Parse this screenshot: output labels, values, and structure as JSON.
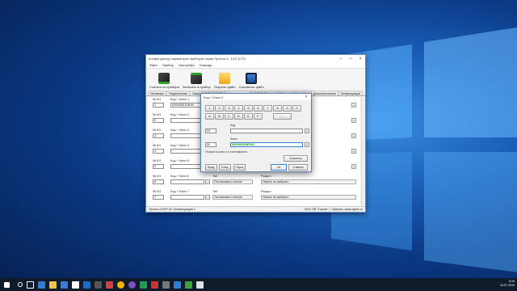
{
  "colors": {
    "accent": "#2f7fd6",
    "key_green": "#1a9a1a"
  },
  "main_window": {
    "title": "Конфигуратор параметров приборов серии Проток-4 - 14.0 (173)",
    "menu": [
      "Файл",
      "Прибор",
      "Настройка",
      "Помощь"
    ],
    "toolbar": [
      {
        "label": "Считать из прибора",
        "icon": "read-device-icon"
      },
      {
        "label": "Записать в прибор",
        "icon": "write-device-icon"
      },
      {
        "label": "Открыть файл",
        "icon": "folder-icon"
      },
      {
        "label": "Сохранить файл",
        "icon": "floppy-icon"
      }
    ],
    "tabs": [
      "Основные",
      "Подключение",
      "Связь",
      "GSM",
      "Wi-Fi",
      "Ключи и входы",
      "SMS",
      "Питание",
      "Выходы",
      "Шлейфы",
      "Дополнительные",
      "Конфигурация"
    ],
    "rows": [
      {
        "mkko": "№ КО",
        "mkko_val": "1",
        "key_label": "Код + Ключ 1",
        "key_val": "000083E3DB90",
        "type_label": "",
        "type_val": "",
        "section_label": "",
        "section_val": ""
      },
      {
        "mkko": "№ КО",
        "mkko_val": "2",
        "key_label": "Код + Ключ 2",
        "key_val": "",
        "type_label": "",
        "type_val": "",
        "section_label": "",
        "section_val": ""
      },
      {
        "mkko": "№ КО",
        "mkko_val": "3",
        "key_label": "Код + Ключ 3",
        "key_val": "",
        "type_label": "",
        "type_val": "",
        "section_label": "",
        "section_val": ""
      },
      {
        "mkko": "№ КО",
        "mkko_val": "4",
        "key_label": "Код + Ключ 4",
        "key_val": "",
        "type_label": "",
        "type_val": "",
        "section_label": "",
        "section_val": ""
      },
      {
        "mkko": "№ КО",
        "mkko_val": "5",
        "key_label": "Код + Ключ 5",
        "key_val": "",
        "type_label": "",
        "type_val": "",
        "section_label": "",
        "section_val": ""
      },
      {
        "mkko": "№ КО",
        "mkko_val": "6",
        "key_label": "Код + Ключ 6",
        "key_val": "",
        "type_label": "Тип",
        "type_val": "Постановка и снятие",
        "section_label": "Раздел",
        "section_val": "Начать не выбрано"
      },
      {
        "mkko": "№ КО",
        "mkko_val": "7",
        "key_label": "Код + Ключ 7",
        "key_val": "",
        "type_label": "Тип",
        "type_val": "Постановка и снятие",
        "section_label": "Раздел",
        "section_val": "Начать не выбрано"
      }
    ],
    "status_left": "Проток-4-KOP-04, Конфигурация 2",
    "status_right": "ООО ОВ \"Сигран\", г. Иркутск, www.sigran.ru"
  },
  "dialog": {
    "title": "Код + Ключ 2",
    "digits": [
      "1",
      "2",
      "3",
      "4",
      "5",
      "6",
      "7",
      "8",
      "9",
      "0"
    ],
    "letters": [
      "A",
      "B",
      "C",
      "D",
      "E",
      "F"
    ],
    "backspace": "←",
    "code_label": "Код",
    "code_prefix": "00",
    "code_value": "",
    "key_label": "Ключ",
    "key_prefix": "00",
    "key_value": "000083A0BFAD",
    "hint": "Получить ключ со считывателя",
    "btn_clear": "Очистить",
    "btn_prev": "Пред.",
    "btn_next": "След.",
    "btn_reset": "Сброс",
    "btn_ok": "Ок",
    "btn_cancel": "Отмена"
  },
  "taskbar": {
    "time": "8:16",
    "date": "15.07.2019"
  }
}
